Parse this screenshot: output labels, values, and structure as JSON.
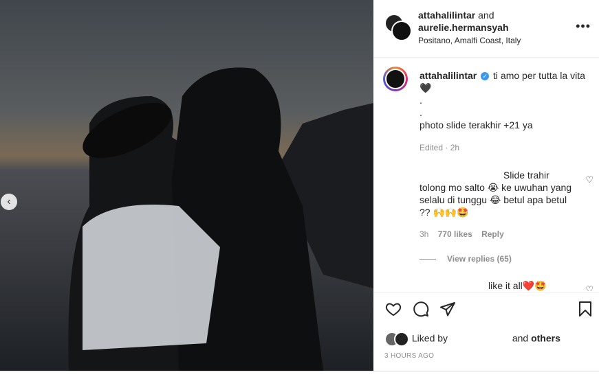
{
  "post": {
    "header": {
      "user1": "attahalilintar",
      "and": "and",
      "user2": "aurelie.hermansyah",
      "location": "Positano, Amalfi Coast, Italy",
      "more_icon": "ellipsis-icon"
    },
    "caption": {
      "username": "attahalilintar",
      "text_line1": "ti amo per tutta la vita",
      "heart": "🖤",
      "dot1": ".",
      "dot2": ".",
      "text_line2": "photo slide terakhir +21 ya",
      "edited": "Edited · 2h"
    },
    "comment": {
      "text_a": "Slide trahir",
      "text_b": "tolong mo salto 😭 ke uwuhan yang selalu di tunggu 😂 betul apa betul ?? 🙌🙌🤩",
      "time": "3h",
      "likes": "770 likes",
      "reply": "Reply",
      "view_replies": "View replies (65)"
    },
    "comment2": {
      "text": "like it all❤️🤩"
    },
    "liked_by": {
      "prefix": "Liked by",
      "suffix": "and",
      "others": "others"
    },
    "time_ago": "3 HOURS AGO"
  }
}
